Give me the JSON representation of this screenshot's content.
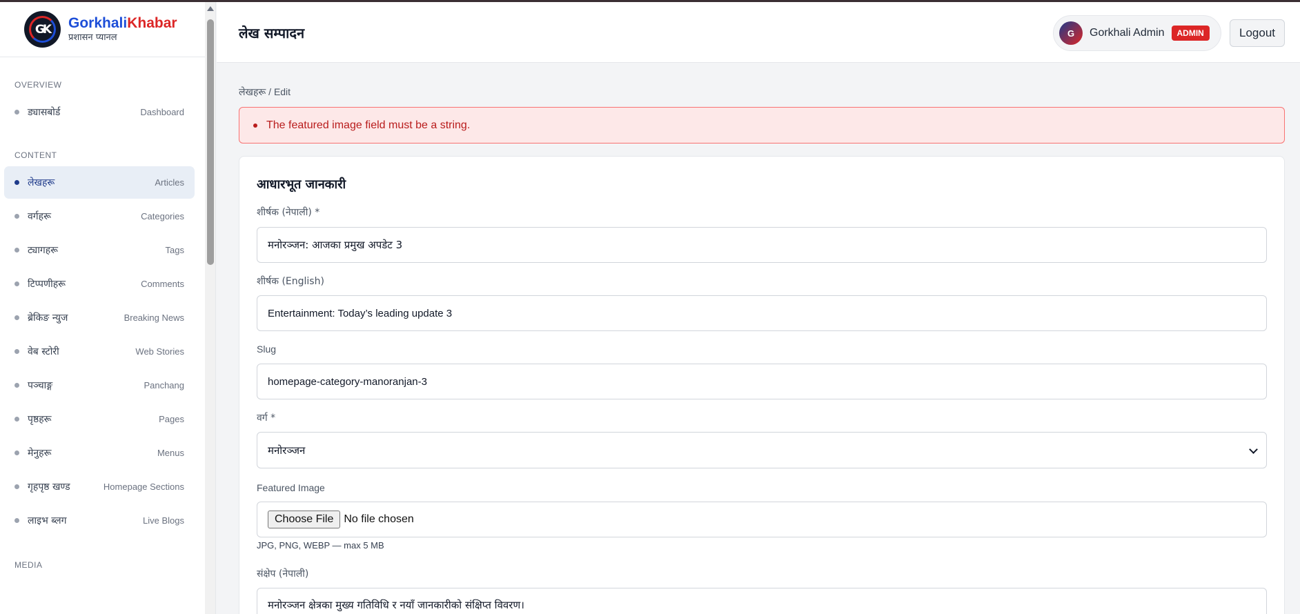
{
  "brand": {
    "name_part1": "Gorkhali",
    "name_part2": "Khabar",
    "subtitle": "प्रशासन प्यानल",
    "logo_text": "GK"
  },
  "sidebar": {
    "sections": [
      {
        "title": "OVERVIEW"
      },
      {
        "title": "CONTENT"
      },
      {
        "title": "MEDIA"
      }
    ],
    "overview_items": [
      {
        "np": "ड्यासबोर्ड",
        "en": "Dashboard"
      }
    ],
    "content_items": [
      {
        "np": "लेखहरू",
        "en": "Articles",
        "active": true
      },
      {
        "np": "वर्गहरू",
        "en": "Categories"
      },
      {
        "np": "ट्यागहरू",
        "en": "Tags"
      },
      {
        "np": "टिप्पणीहरू",
        "en": "Comments"
      },
      {
        "np": "ब्रेकिङ न्युज",
        "en": "Breaking News"
      },
      {
        "np": "वेब स्टोरी",
        "en": "Web Stories"
      },
      {
        "np": "पञ्चाङ्ग",
        "en": "Panchang"
      },
      {
        "np": "पृष्ठहरू",
        "en": "Pages"
      },
      {
        "np": "मेनुहरू",
        "en": "Menus"
      },
      {
        "np": "गृहपृष्ठ खण्ड",
        "en": "Homepage Sections"
      },
      {
        "np": "लाइभ ब्लग",
        "en": "Live Blogs"
      }
    ]
  },
  "header": {
    "title": "लेख सम्पादन",
    "user_initial": "G",
    "user_name": "Gorkhali Admin",
    "role": "ADMIN",
    "logout_label": "Logout"
  },
  "breadcrumb": {
    "parent": "लेखहरू",
    "separator": " / ",
    "current": "Edit"
  },
  "error": {
    "message": "The featured image field must be a string."
  },
  "form": {
    "section_title": "आधारभूत जानकारी",
    "title_np": {
      "label": "शीर्षक (नेपाली) *",
      "value": "मनोरञ्जन: आजका प्रमुख अपडेट 3"
    },
    "title_en": {
      "label": "शीर्षक (English)",
      "value": "Entertainment: Today’s leading update 3"
    },
    "slug": {
      "label": "Slug",
      "value": "homepage-category-manoranjan-3"
    },
    "category": {
      "label": "वर्ग *",
      "value": "मनोरञ्जन"
    },
    "featured_image": {
      "label": "Featured Image",
      "button_label": "Choose File",
      "status": "No file chosen",
      "hint": "JPG, PNG, WEBP — max 5 MB"
    },
    "summary_np": {
      "label": "संक्षेप (नेपाली)",
      "value": "मनोरञ्जन क्षेत्रका मुख्य गतिविधि र नयाँ जानकारीको संक्षिप्त विवरण।"
    }
  },
  "colors": {
    "brand_blue": "#1d4ed8",
    "brand_red": "#dc2626",
    "active_nav_bg": "#e8eef6",
    "error_bg": "#fde8e8",
    "error_text": "#b91c1c",
    "role_badge": "#dc2626"
  }
}
